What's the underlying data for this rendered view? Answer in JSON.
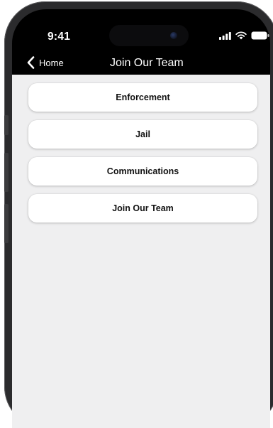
{
  "status_bar": {
    "time": "9:41",
    "icons": [
      "signal-icon",
      "wifi-icon",
      "battery-icon"
    ]
  },
  "nav": {
    "back_label": "Home",
    "title": "Join Our Team"
  },
  "menu": {
    "items": [
      {
        "label": "Enforcement"
      },
      {
        "label": "Jail"
      },
      {
        "label": "Communications"
      },
      {
        "label": "Join Our Team"
      }
    ]
  },
  "colors": {
    "nav_background": "#000000",
    "content_background": "#efeff0",
    "card_background": "#ffffff"
  }
}
